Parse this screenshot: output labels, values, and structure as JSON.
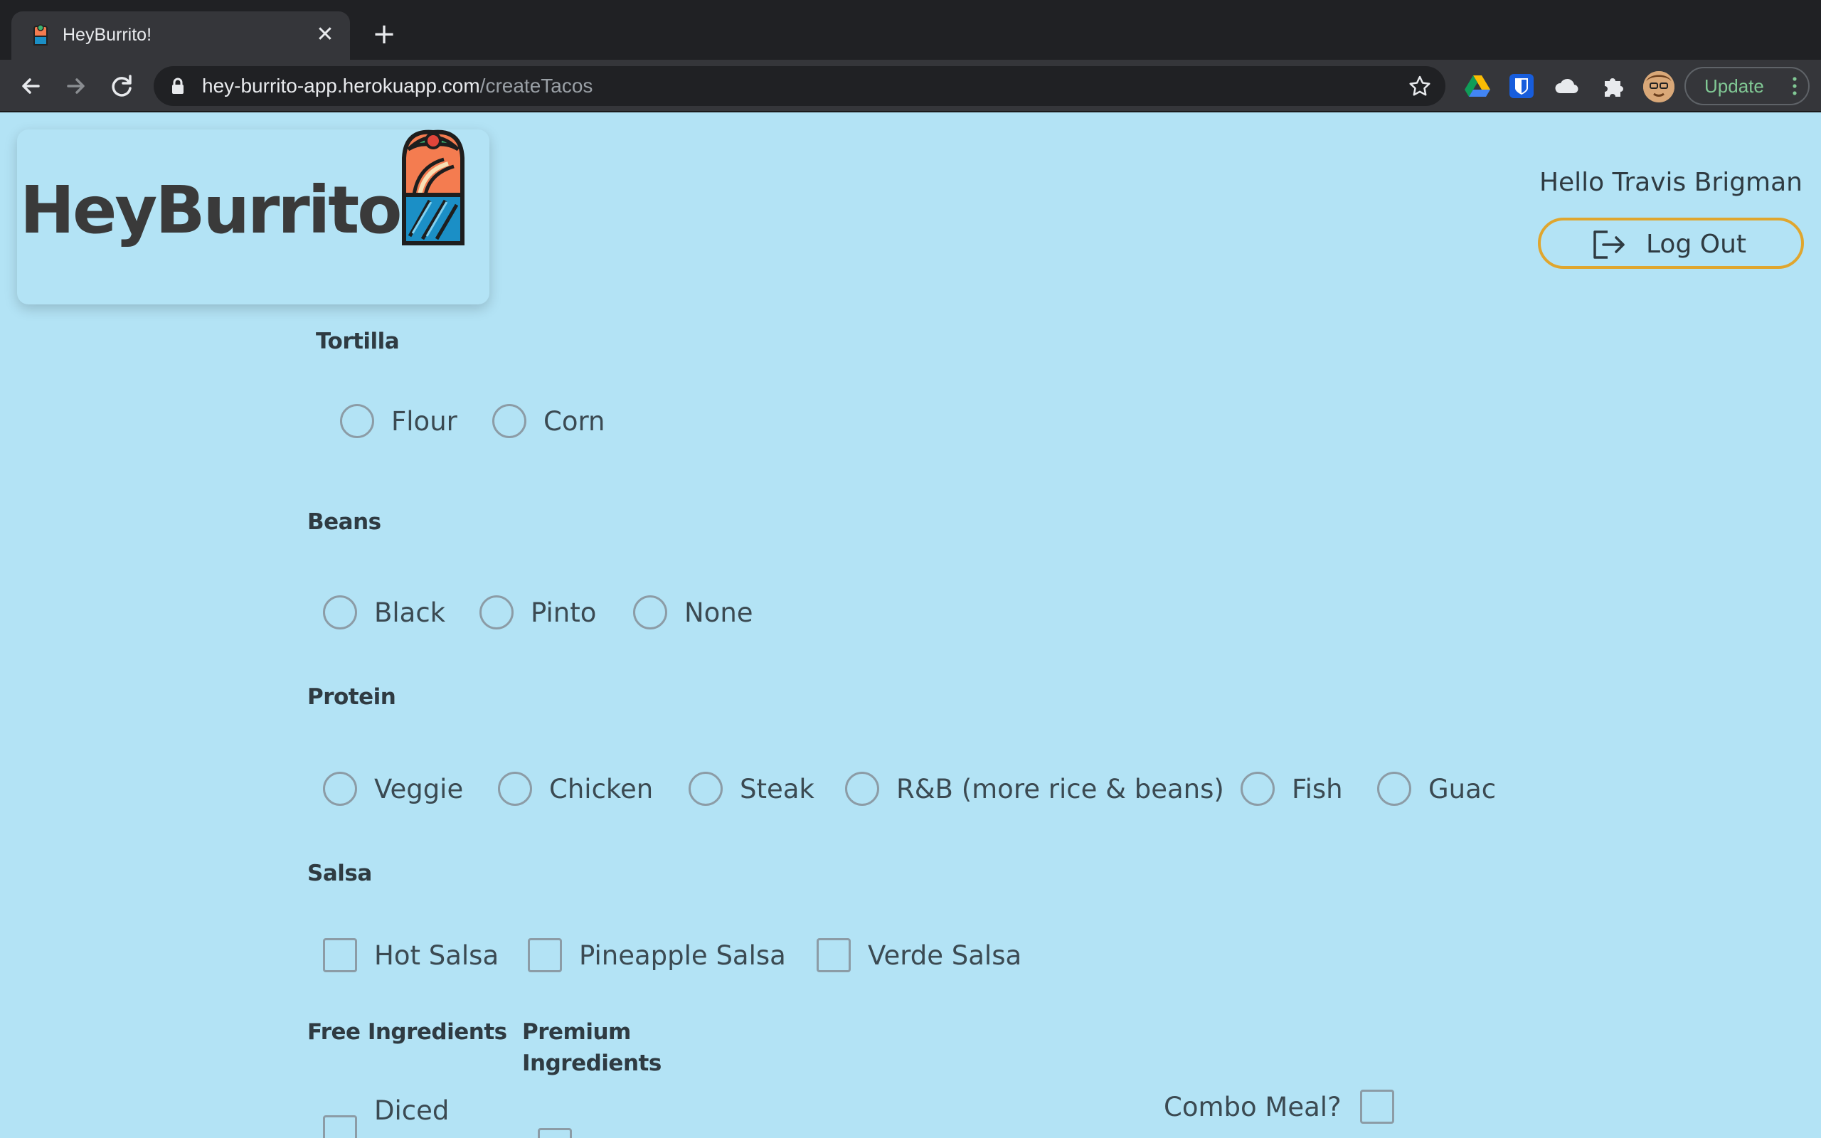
{
  "browser": {
    "tab_title": "HeyBurrito!",
    "url_domain": "hey-burrito-app.herokuapp.com",
    "url_path": "/createTacos",
    "update_label": "Update"
  },
  "header": {
    "logo_text": "HeyBurrito!",
    "greeting": "Hello Travis Brigman",
    "logout_label": "Log Out"
  },
  "form": {
    "tortilla": {
      "title": "Tortilla",
      "options": [
        "Flour",
        "Corn"
      ]
    },
    "beans": {
      "title": "Beans",
      "options": [
        "Black",
        "Pinto",
        "None"
      ]
    },
    "protein": {
      "title": "Protein",
      "options": [
        "Veggie",
        "Chicken",
        "Steak",
        "R&B (more rice & beans)",
        "Fish",
        "Guac"
      ]
    },
    "salsa": {
      "title": "Salsa",
      "options": [
        "Hot Salsa",
        "Pineapple Salsa",
        "Verde Salsa"
      ]
    },
    "free_ingredients": {
      "title": "Free Ingredients",
      "first_option": "Diced"
    },
    "premium_ingredients": {
      "title_line1": "Premium",
      "title_line2": "Ingredients"
    },
    "combo_label": "Combo Meal?"
  },
  "colors": {
    "page_bg": "#b3e3f5",
    "logout_border": "#e0a62e",
    "text": "#3b4a52"
  },
  "icons": [
    "back-icon",
    "forward-icon",
    "reload-icon",
    "lock-icon",
    "star-icon",
    "google-drive-icon",
    "bitwarden-icon",
    "cloud-icon",
    "extensions-icon",
    "logout-icon"
  ]
}
